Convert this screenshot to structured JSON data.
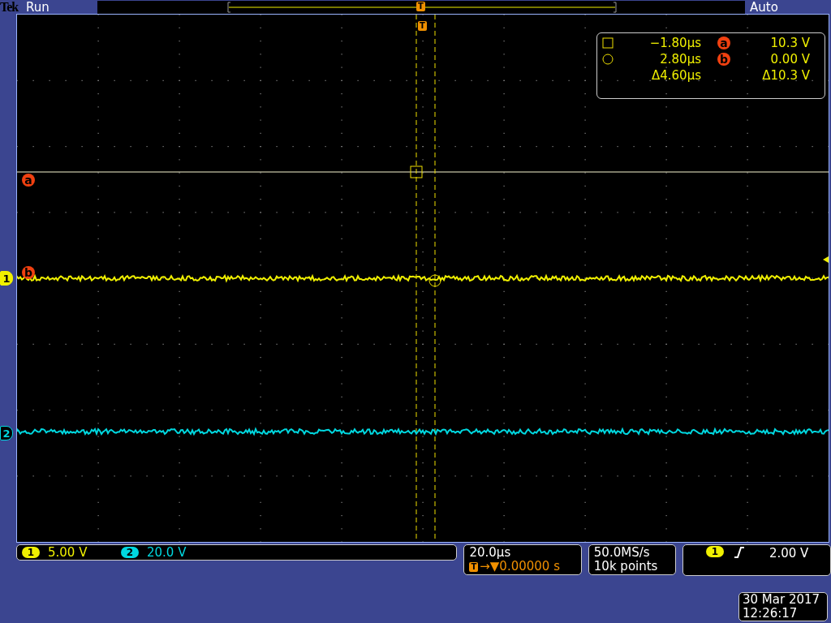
{
  "header": {
    "brand": "Tek",
    "state": "Run",
    "trigger_mode": "Auto",
    "trigger_tag": "T"
  },
  "graticule": {
    "trigger_tag": "T",
    "cursor_markers": [
      "a",
      "b"
    ],
    "readout": [
      {
        "kind": "square",
        "time": "−1.80µs",
        "marker": "a",
        "value": "10.3 V"
      },
      {
        "kind": "circle",
        "time": "2.80µs",
        "marker": "b",
        "value": "0.00 V"
      },
      {
        "kind": "delta",
        "time": "Δ4.60µs",
        "value": "Δ10.3 V"
      }
    ]
  },
  "channels": [
    {
      "label": "1",
      "badge": "1",
      "scale": "5.00 V",
      "color": "#f0f000"
    },
    {
      "label": "2",
      "badge": "2",
      "scale": "20.0 V",
      "color": "#00d8e0"
    }
  ],
  "timebase": {
    "scale": "20.0µs",
    "trigger_tag": "T",
    "position": "→▼0.00000 s"
  },
  "acquisition": {
    "sample_rate": "50.0MS/s",
    "record_length": "10k points"
  },
  "trigger": {
    "source": "1",
    "level": "2.00 V"
  },
  "datetime": {
    "date": "30 Mar 2017",
    "time": "12:26:17"
  }
}
